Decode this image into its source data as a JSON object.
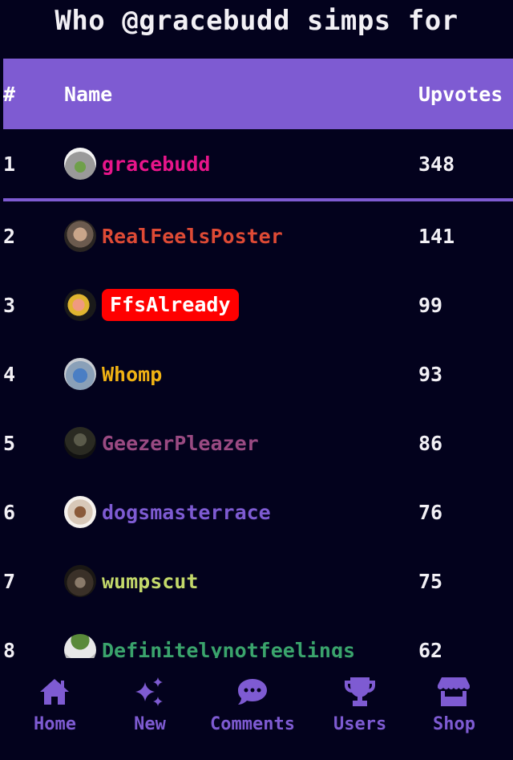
{
  "page": {
    "title": "Who @gracebudd simps for"
  },
  "table": {
    "headers": {
      "rank": "#",
      "name": "Name",
      "upvotes": "Upvotes"
    },
    "rows": [
      {
        "rank": "1",
        "name": "gracebudd",
        "upvotes": "348",
        "color": "#e8158a",
        "avatar": "pepe-hood-avatar",
        "badge": false
      },
      {
        "rank": "2",
        "name": "RealFeelsPoster",
        "upvotes": "141",
        "color": "#de4a35",
        "avatar": "bearded-man-avatar",
        "badge": false
      },
      {
        "rank": "3",
        "name": "FfsAlready",
        "upvotes": "99",
        "color": "#ffffff",
        "badge_color": "#ff0000",
        "avatar": "fist-avatar",
        "badge": true
      },
      {
        "rank": "4",
        "name": "Whomp",
        "upvotes": "93",
        "color": "#f0b214",
        "avatar": "blue-splash-avatar",
        "badge": false
      },
      {
        "rank": "5",
        "name": "GeezerPleazer",
        "upvotes": "86",
        "color": "#9a4a82",
        "avatar": "dark-portrait-avatar",
        "badge": false
      },
      {
        "rank": "6",
        "name": "dogsmasterrace",
        "upvotes": "76",
        "color": "#7e5bd2",
        "avatar": "pitbull-avatar",
        "badge": false
      },
      {
        "rank": "7",
        "name": "wumpscut",
        "upvotes": "75",
        "color": "#c3d86a",
        "avatar": "dark-hair-avatar",
        "badge": false
      },
      {
        "rank": "8",
        "name": "Definitelynotfeelings",
        "upvotes": "62",
        "color": "#3aa46c",
        "avatar": "sketch-face-avatar",
        "badge": false
      }
    ]
  },
  "nav": {
    "items": [
      {
        "label": "Home",
        "icon": "home-icon"
      },
      {
        "label": "New",
        "icon": "sparkles-icon"
      },
      {
        "label": "Comments",
        "icon": "comment-icon"
      },
      {
        "label": "Users",
        "icon": "trophy-icon"
      },
      {
        "label": "Shop",
        "icon": "shop-icon"
      }
    ]
  },
  "colors": {
    "background": "#03021d",
    "accent": "#7e5bd2",
    "text": "#f2f0f5"
  }
}
